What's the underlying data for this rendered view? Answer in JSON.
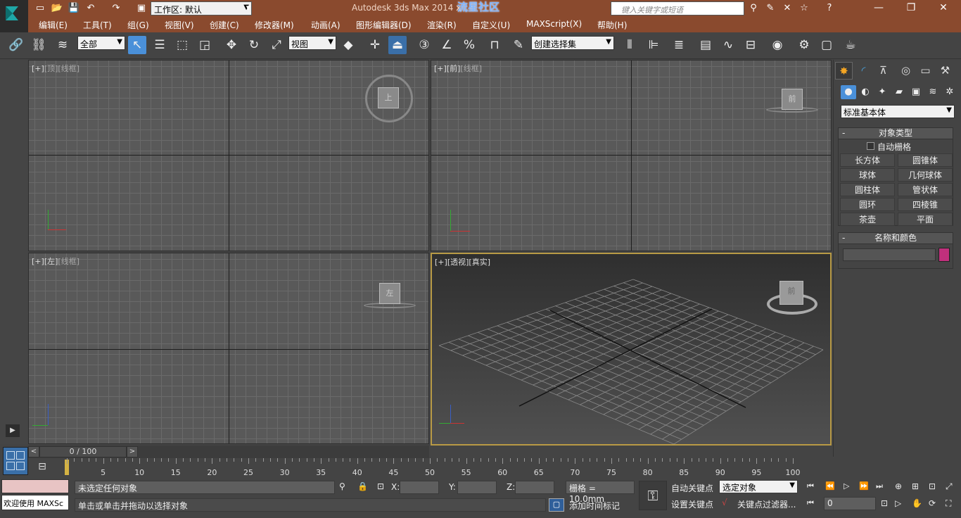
{
  "title_bar": {
    "workspace_combo": "工作区: 默认",
    "app_title": "Autodesk 3ds Max  2014 x",
    "watermark": "流星社区",
    "search_placeholder": "键入关键字或短语"
  },
  "menu": {
    "items": [
      "编辑(E)",
      "工具(T)",
      "组(G)",
      "视图(V)",
      "创建(C)",
      "修改器(M)",
      "动画(A)",
      "图形编辑器(D)",
      "渲染(R)",
      "自定义(U)",
      "MAXScript(X)",
      "帮助(H)"
    ]
  },
  "toolbar": {
    "selection_filter": "全部",
    "reference_coord": "视图",
    "named_selection_set": "创建选择集"
  },
  "viewports": {
    "top": {
      "bracket": "[+]",
      "view": "[顶]",
      "shading": "[线框]",
      "cube_label": "上"
    },
    "front": {
      "bracket": "[+]",
      "view": "[前]",
      "shading": "[线框]",
      "cube_label": "前"
    },
    "left": {
      "bracket": "[+]",
      "view": "[左]",
      "shading": "[线框]",
      "cube_label": "左"
    },
    "perspective": {
      "bracket": "[+]",
      "view": "[透视]",
      "shading": "[真实]",
      "cube_label": "前"
    }
  },
  "command_panel": {
    "category": "标准基本体",
    "object_type_title": "对象类型",
    "auto_grid_label": "自动栅格",
    "object_buttons": [
      "长方体",
      "圆锥体",
      "球体",
      "几何球体",
      "圆柱体",
      "管状体",
      "圆环",
      "四棱锥",
      "茶壶",
      "平面"
    ],
    "name_color_title": "名称和颜色",
    "swatch_color": "#c0307c"
  },
  "time_slider": {
    "frame_display": "0 / 100"
  },
  "timeline": {
    "ticks": [
      "0",
      "5",
      "10",
      "15",
      "20",
      "25",
      "30",
      "35",
      "40",
      "45",
      "50",
      "55",
      "60",
      "65",
      "70",
      "75",
      "80",
      "85",
      "90",
      "95",
      "100"
    ]
  },
  "status": {
    "maxscript_listener": "欢迎使用 MAXSc",
    "selection_status": "未选定任何对象",
    "prompt": "单击或单击并拖动以选择对象",
    "x_label": "X:",
    "y_label": "Y:",
    "z_label": "Z:",
    "grid_size": "栅格 = 10.0mm",
    "auto_key": "自动关键点",
    "set_key": "设置关键点",
    "key_target": "选定对象",
    "key_filters": "关键点过滤器...",
    "add_time_tag": "添加时间标记",
    "current_frame": "0"
  },
  "colors": {
    "title_bar": "#8a4a2e",
    "active_viewport_border": "#b89a45",
    "active_tool": "#4a90d9"
  }
}
